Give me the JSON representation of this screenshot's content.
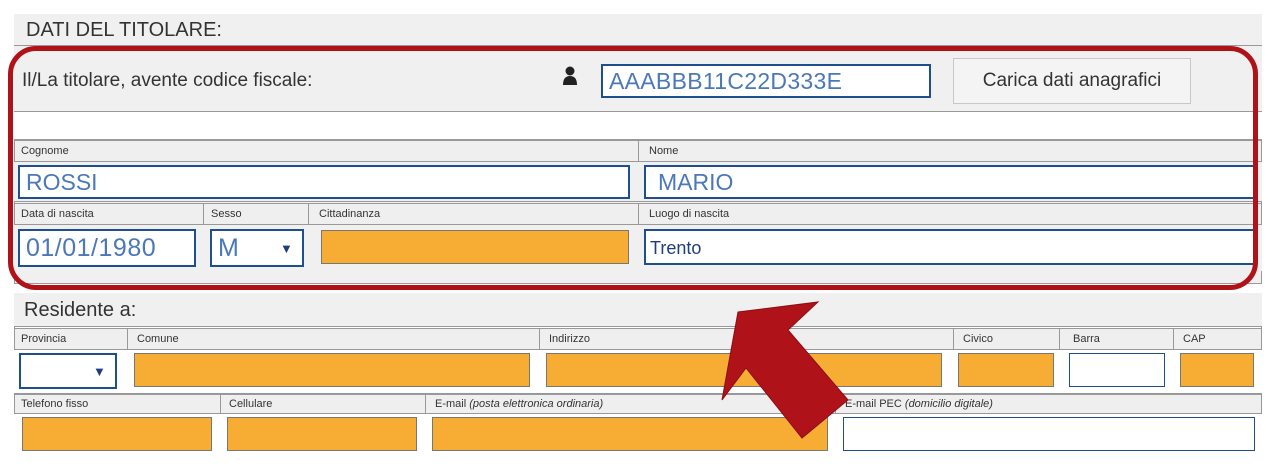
{
  "holder": {
    "title": "DATI DEL TITOLARE:",
    "fiscal_label": "Il/La titolare, avente codice fiscale:",
    "fiscal_value": "AAABBB11C22D333E",
    "load_button": "Carica dati anagrafici",
    "surname_label": "Cognome",
    "surname_value": "ROSSI",
    "name_label": "Nome",
    "name_value": "MARIO",
    "birth_date_label": "Data di nascita",
    "birth_date_value": "01/01/1980",
    "sex_label": "Sesso",
    "sex_value": "M",
    "citizenship_label": "Cittadinanza",
    "citizenship_value": "",
    "birthplace_label": "Luogo di nascita",
    "birthplace_value": "Trento"
  },
  "residence": {
    "title": "Residente a:",
    "province_label": "Provincia",
    "province_value": "",
    "comune_label": "Comune",
    "address_label": "Indirizzo",
    "civic_label": "Civico",
    "slash_label": "Barra",
    "cap_label": "CAP",
    "phone_label": "Telefono fisso",
    "mobile_label": "Cellulare",
    "email_label": "E-mail",
    "email_note": "(posta elettronica ordinaria)",
    "pec_label": "E-mail PEC",
    "pec_note": "(domicilio digitale)"
  },
  "colors": {
    "highlight": "#b0121a",
    "required_field": "#f7ad34",
    "field_border": "#1f4e8c",
    "value_text": "#4a78b8"
  },
  "icons": {
    "user": "user-icon",
    "dropdown": "caret-down-icon",
    "arrow": "arrow-pointer"
  }
}
